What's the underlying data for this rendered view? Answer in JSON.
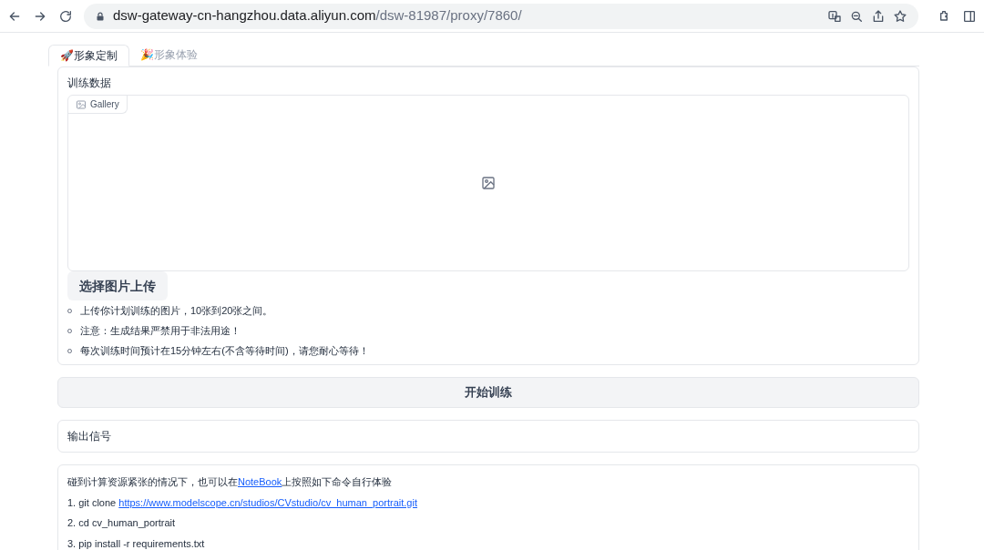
{
  "browser": {
    "url_host": "dsw-gateway-cn-hangzhou.data.aliyun.com",
    "url_path": "/dsw-81987/proxy/7860/"
  },
  "tabs": [
    {
      "label": "🚀形象定制",
      "selected": true
    },
    {
      "label": "🎉形象体验",
      "selected": false
    }
  ],
  "training": {
    "label": "训练数据",
    "gallery_label": "Gallery",
    "upload_button": "选择图片上传",
    "notes": [
      "上传你计划训练的图片，10张到20张之间。",
      "注意：生成结果严禁用于非法用途！",
      "每次训练时间预计在15分钟左右(不含等待时间)，请您耐心等待！"
    ]
  },
  "start_button": "开始训练",
  "output": {
    "label": "输出信号"
  },
  "instructions": {
    "intro": {
      "before": "碰到计算资源紧张的情况下，也可以在",
      "link": "NoteBook",
      "after": "上按照如下命令自行体验"
    },
    "steps": [
      {
        "text": "1. git clone ",
        "link": "https://www.modelscope.cn/studios/CVstudio/cv_human_portrait.git"
      },
      {
        "text": "2. cd cv_human_portrait"
      },
      {
        "text": "3. pip install -r requirements.txt"
      }
    ]
  }
}
